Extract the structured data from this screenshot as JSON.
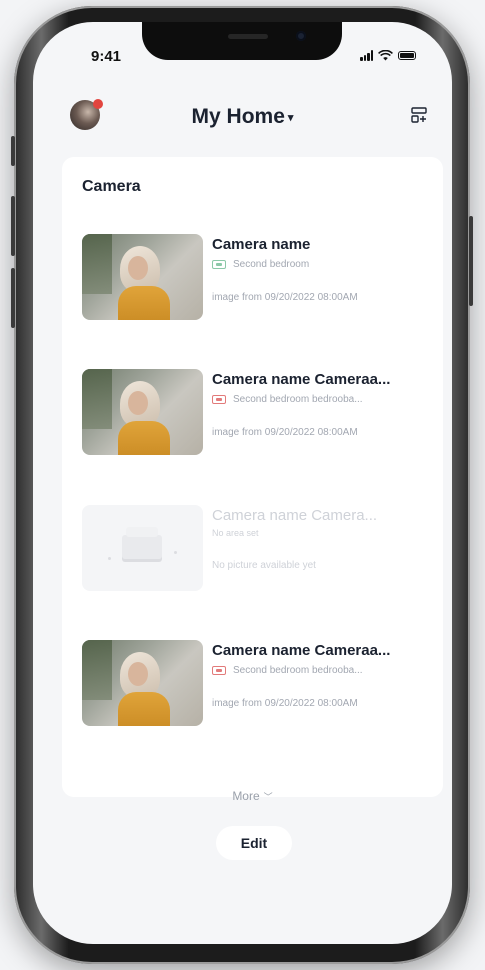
{
  "status_bar": {
    "time": "9:41"
  },
  "header": {
    "title": "My Home"
  },
  "section": {
    "title": "Camera"
  },
  "cameras": [
    {
      "name": "Camera name",
      "location": "Second bedroom",
      "status": "online",
      "image_text": "image from 09/20/2022 08:00AM"
    },
    {
      "name": "Camera name Cameraa...",
      "location": "Second bedroom bedrooba...",
      "status": "offline",
      "image_text": "image from 09/20/2022 08:00AM"
    },
    {
      "name": "Camera name Camera...",
      "location": "No area set",
      "status": "unset",
      "image_text": "No picture available yet"
    },
    {
      "name": "Camera name Cameraa...",
      "location": "Second bedroom bedrooba...",
      "status": "offline",
      "image_text": "image from 09/20/2022 08:00AM"
    }
  ],
  "more_label": "More",
  "edit_label": "Edit",
  "colors": {
    "online_tag": "#8cc8a8",
    "offline_tag": "#e27a7a",
    "primary_text": "#1b2230",
    "secondary_text": "#a2a7b1"
  },
  "icons": [
    "avatar",
    "caret-down-icon",
    "add-device-icon",
    "chevron-down-icon",
    "signal-icon",
    "wifi-icon",
    "battery-icon"
  ]
}
